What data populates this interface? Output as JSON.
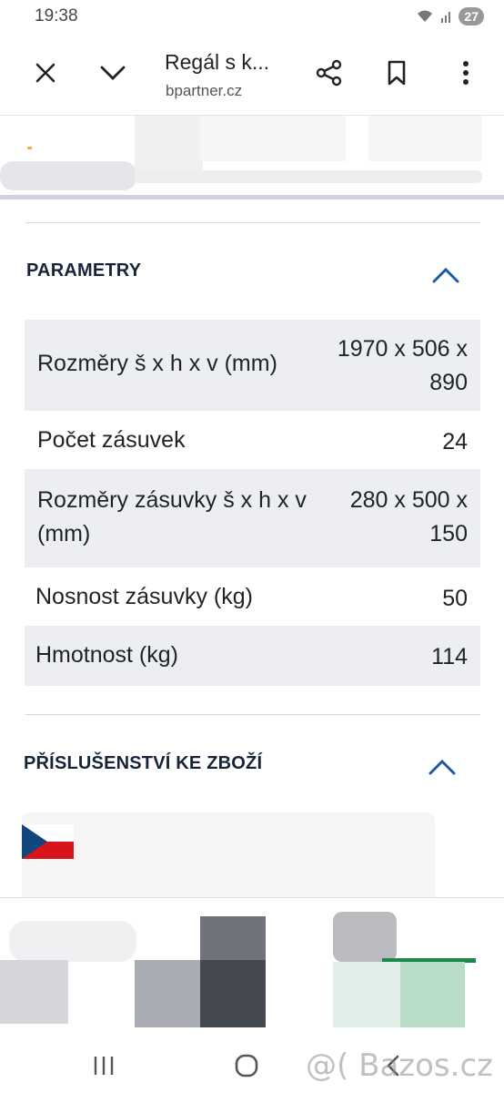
{
  "status_bar": {
    "time": "19:38",
    "battery": "27"
  },
  "browser": {
    "title": "Regál s k...",
    "url": "bpartner.cz",
    "icons": [
      "close-icon",
      "chevron-down-icon",
      "share-icon",
      "bookmark-icon",
      "more-vertical-icon"
    ]
  },
  "parameters": {
    "heading": "PARAMETRY",
    "rows": [
      {
        "label": "Rozměry š x h x v (mm)",
        "value": "1970 x 506 x 890"
      },
      {
        "label": "Počet zásuvek",
        "value": "24"
      },
      {
        "label": "Rozměry zásuvky š x h x v (mm)",
        "value": "280 x 500 x 150"
      },
      {
        "label": "Nosnost zásuvky (kg)",
        "value": "50"
      },
      {
        "label": "Hmotnost (kg)",
        "value": "114"
      }
    ]
  },
  "accessories": {
    "heading": "PŘÍSLUŠENSTVÍ KE ZBOŽÍ"
  },
  "colors": {
    "heading": "#16243a",
    "accent_chevron": "#1e5aa8",
    "row_shade": "#eceef1"
  },
  "watermark": "@( Bazos.cz"
}
